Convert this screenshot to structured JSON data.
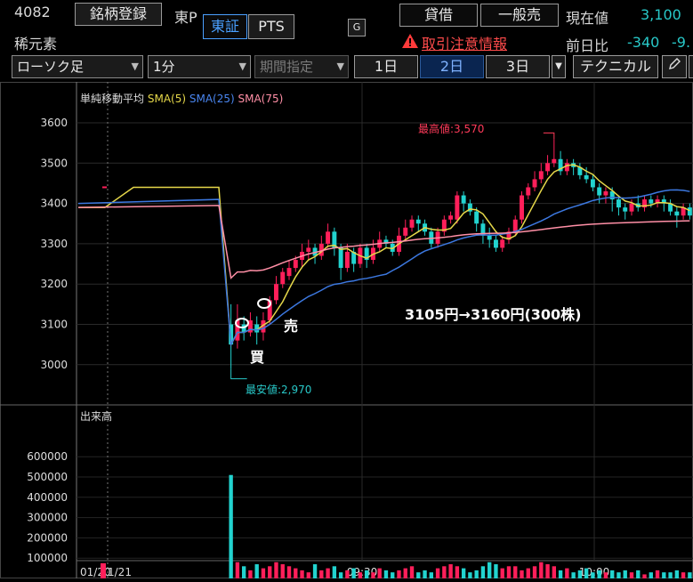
{
  "stock": {
    "code": "4082",
    "name": "稀元素",
    "market": "東P"
  },
  "header": {
    "register_label": "銘柄登録",
    "venue_tse": "東証",
    "venue_pts": "PTS",
    "margin_label": "貸借",
    "general_sell_label": "一般売",
    "current_price_label": "現在値",
    "current_price": "3,100",
    "prev_diff_label": "前日比",
    "prev_diff": "-340",
    "prev_diff_pct": "-9.",
    "alert_label": "取引注意情報"
  },
  "toolbar": {
    "chart_type": "ローソク足",
    "interval": "1分",
    "period_label": "期間指定",
    "range_1d": "1日",
    "range_2d": "2日",
    "range_3d": "3日",
    "technical_label": "テクニカル"
  },
  "indicators": {
    "title": "単純移動平均",
    "sma5": "SMA(5)",
    "sma25": "SMA(25)",
    "sma75": "SMA(75)"
  },
  "annotations": {
    "high": "最高値:3,570",
    "low": "最安値:2,970",
    "trade_summary": "3105円→3160円(300株)",
    "buy": "買",
    "sell": "売"
  },
  "colors": {
    "up": "#ff1f5a",
    "down": "#22d3cf",
    "sma5": "#e6d84a",
    "sma25": "#3c78e0",
    "sma75": "#ff8fa6"
  },
  "chart_data": {
    "type": "candlestick",
    "price_axis": {
      "ticks": [
        3000,
        3100,
        3200,
        3300,
        3400,
        3500,
        3600
      ]
    },
    "volume_axis": {
      "label": "出来高",
      "ticks": [
        100000,
        200000,
        300000,
        400000,
        500000,
        600000
      ]
    },
    "x_labels": [
      "01/20",
      "1/21",
      "09:30",
      "10:00"
    ],
    "candles": [
      [
        3100,
        3050,
        3150,
        2990
      ],
      [
        3060,
        3110,
        3150,
        3040
      ],
      [
        3100,
        3080,
        3120,
        3060
      ],
      [
        3080,
        3110,
        3130,
        3070
      ],
      [
        3100,
        3080,
        3120,
        3050
      ],
      [
        3080,
        3110,
        3130,
        3060
      ],
      [
        3110,
        3160,
        3170,
        3100
      ],
      [
        3160,
        3200,
        3220,
        3150
      ],
      [
        3200,
        3230,
        3240,
        3190
      ],
      [
        3220,
        3240,
        3260,
        3210
      ],
      [
        3240,
        3260,
        3270,
        3230
      ],
      [
        3260,
        3280,
        3300,
        3240
      ],
      [
        3280,
        3290,
        3310,
        3260
      ],
      [
        3290,
        3270,
        3300,
        3250
      ],
      [
        3270,
        3300,
        3320,
        3260
      ],
      [
        3300,
        3330,
        3350,
        3290
      ],
      [
        3330,
        3290,
        3340,
        3270
      ],
      [
        3290,
        3240,
        3300,
        3210
      ],
      [
        3240,
        3280,
        3300,
        3230
      ],
      [
        3280,
        3250,
        3290,
        3230
      ],
      [
        3250,
        3290,
        3300,
        3240
      ],
      [
        3290,
        3260,
        3300,
        3240
      ],
      [
        3260,
        3290,
        3310,
        3250
      ],
      [
        3290,
        3310,
        3330,
        3280
      ],
      [
        3310,
        3300,
        3320,
        3290
      ],
      [
        3300,
        3280,
        3310,
        3270
      ],
      [
        3280,
        3320,
        3340,
        3270
      ],
      [
        3320,
        3340,
        3360,
        3310
      ],
      [
        3340,
        3360,
        3370,
        3330
      ],
      [
        3360,
        3350,
        3370,
        3330
      ],
      [
        3350,
        3330,
        3360,
        3320
      ],
      [
        3330,
        3300,
        3340,
        3290
      ],
      [
        3300,
        3330,
        3340,
        3290
      ],
      [
        3330,
        3360,
        3370,
        3320
      ],
      [
        3360,
        3370,
        3380,
        3350
      ],
      [
        3360,
        3420,
        3430,
        3350
      ],
      [
        3420,
        3400,
        3430,
        3380
      ],
      [
        3400,
        3380,
        3410,
        3370
      ],
      [
        3380,
        3350,
        3390,
        3330
      ],
      [
        3350,
        3320,
        3360,
        3300
      ],
      [
        3320,
        3310,
        3340,
        3290
      ],
      [
        3310,
        3290,
        3320,
        3280
      ],
      [
        3290,
        3310,
        3320,
        3280
      ],
      [
        3310,
        3330,
        3340,
        3300
      ],
      [
        3330,
        3360,
        3370,
        3320
      ],
      [
        3360,
        3420,
        3430,
        3350
      ],
      [
        3420,
        3440,
        3450,
        3410
      ],
      [
        3440,
        3460,
        3480,
        3430
      ],
      [
        3460,
        3480,
        3500,
        3450
      ],
      [
        3480,
        3500,
        3520,
        3470
      ],
      [
        3500,
        3510,
        3560,
        3490
      ],
      [
        3510,
        3480,
        3530,
        3470
      ],
      [
        3480,
        3500,
        3510,
        3470
      ],
      [
        3500,
        3490,
        3510,
        3470
      ],
      [
        3490,
        3470,
        3500,
        3460
      ],
      [
        3470,
        3460,
        3490,
        3450
      ],
      [
        3460,
        3440,
        3470,
        3430
      ],
      [
        3440,
        3420,
        3450,
        3400
      ],
      [
        3420,
        3430,
        3440,
        3400
      ],
      [
        3430,
        3410,
        3440,
        3380
      ],
      [
        3410,
        3390,
        3420,
        3370
      ],
      [
        3390,
        3380,
        3400,
        3360
      ],
      [
        3380,
        3400,
        3410,
        3370
      ],
      [
        3400,
        3390,
        3420,
        3380
      ],
      [
        3390,
        3410,
        3420,
        3380
      ],
      [
        3410,
        3400,
        3420,
        3390
      ],
      [
        3400,
        3410,
        3420,
        3390
      ],
      [
        3410,
        3400,
        3420,
        3380
      ],
      [
        3400,
        3380,
        3410,
        3370
      ],
      [
        3380,
        3370,
        3390,
        3340
      ],
      [
        3370,
        3390,
        3400,
        3360
      ],
      [
        3390,
        3370,
        3400,
        3360
      ]
    ],
    "volumes": [
      510000,
      80000,
      60000,
      40000,
      70000,
      50000,
      60000,
      80000,
      70000,
      60000,
      50000,
      40000,
      30000,
      70000,
      40000,
      50000,
      60000,
      30000,
      40000,
      50000,
      30000,
      40000,
      30000,
      50000,
      40000,
      30000,
      40000,
      50000,
      60000,
      30000,
      40000,
      30000,
      50000,
      60000,
      70000,
      60000,
      50000,
      30000,
      40000,
      60000,
      80000,
      70000,
      50000,
      60000,
      60000,
      40000,
      50000,
      60000,
      80000,
      70000,
      60000,
      40000,
      50000,
      30000,
      40000,
      50000,
      30000,
      40000,
      30000,
      40000,
      30000,
      40000,
      30000,
      40000,
      20000,
      30000,
      40000,
      30000,
      30000,
      40000,
      30000,
      30000
    ],
    "pre_volume": 75000,
    "high_value": 3570,
    "low_value": 2970
  }
}
